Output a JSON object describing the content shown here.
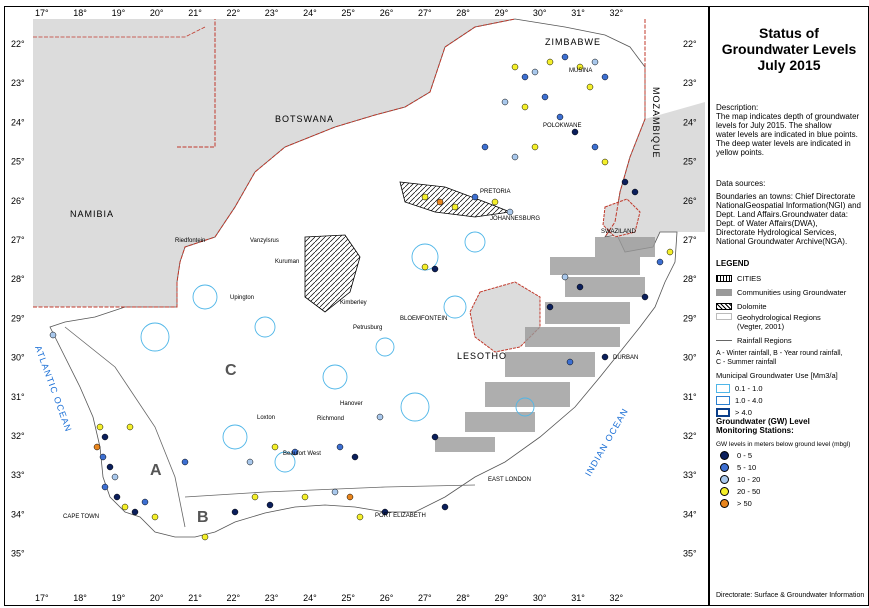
{
  "title_lines": [
    "Status of",
    "Groundwater Levels",
    "July 2015"
  ],
  "description": {
    "heading": "Description:",
    "lines": [
      "The map indicates depth of groundwater",
      "levels for July 2015. The shallow",
      "water levels are indicated in blue points.",
      "The deep water levels are indicated in",
      "yellow points."
    ]
  },
  "data_sources": {
    "heading": "Data sources:",
    "lines": [
      "Boundaries an towns: Chief Directorate",
      "NationalGeospatial Information(NGI) and",
      "Dept. Land Affairs.Groundwater data:",
      "Dept. of Water Affairs(DWA),",
      "Directorate Hydrological Services,",
      "National Groundwater Archive(NGA)."
    ]
  },
  "legend": {
    "heading": "LEGEND",
    "items": [
      {
        "label": "CITIES",
        "icon": "hatch-swatch"
      },
      {
        "label": "Communities using Groundwater",
        "icon": "grey-swatch"
      },
      {
        "label": "Dolomite",
        "icon": "dolomite-swatch"
      }
    ],
    "geohydro_lines": [
      "Geohydrological Regions",
      "(Vegter, 2001)"
    ],
    "rainfall_label": "Rainfall Regions",
    "rainfall_notes": [
      "A - Winter rainfall, B - Year round rainfall,",
      "C - Summer rainfall"
    ],
    "municipal_heading": "Municipal Groundwater Use [Mm3/a]",
    "municipal_items": [
      "0.1 - 1.0",
      "1.0 - 4.0",
      "> 4.0"
    ],
    "gw_heading_lines": [
      "Groundwater (GW) Level",
      "Monitoring Stations:"
    ],
    "gw_subheading": "GW levels in meters below ground level (mbgl)",
    "gw_classes": [
      {
        "label": "0 - 5",
        "color": "#0b1f5c"
      },
      {
        "label": "5 - 10",
        "color": "#3d6fd1"
      },
      {
        "label": "10 - 20",
        "color": "#a9c8ec"
      },
      {
        "label": "20 - 50",
        "color": "#f4ef2a"
      },
      {
        "label": "> 50",
        "color": "#e8851d"
      }
    ]
  },
  "footer": "Directorate: Surface & Groundwater Information",
  "map": {
    "lon_labels": [
      "17°",
      "18°",
      "19°",
      "20°",
      "21°",
      "22°",
      "23°",
      "24°",
      "25°",
      "26°",
      "27°",
      "28°",
      "29°",
      "30°",
      "31°",
      "32°"
    ],
    "lat_labels": [
      "22°",
      "23°",
      "24°",
      "25°",
      "26°",
      "27°",
      "28°",
      "29°",
      "30°",
      "31°",
      "32°",
      "33°",
      "34°",
      "35°"
    ],
    "countries": [
      "ZIMBABWE",
      "BOTSWANA",
      "NAMIBIA",
      "MOZAMBIQUE",
      "SWAZILAND",
      "LESOTHO"
    ],
    "oceans": [
      "ATLANTIC OCEAN",
      "INDIAN OCEAN"
    ],
    "towns": [
      "MUSINA",
      "POLOKWANE",
      "PRETORIA",
      "JOHANNESBURG",
      "Riedfontein",
      "Vanzylsrus",
      "Kuruman",
      "Upington",
      "Kimberley",
      "BLOEMFONTEIN",
      "Petrusburg",
      "Hanover",
      "Loxton",
      "Richmond",
      "Beaufort West",
      "EAST LONDON",
      "PORT ELIZABETH",
      "CAPE TOWN",
      "DURBAN"
    ],
    "regions": [
      "A",
      "B",
      "C"
    ]
  },
  "colors": {
    "neighbor_fill": "#dcdcdc",
    "sa_fill": "#ffffff",
    "ocean": "#ffffff",
    "border_red": "#c0392b",
    "aquifer_blue": "#4fb6e8",
    "community_grey": "#9a9a9a"
  }
}
